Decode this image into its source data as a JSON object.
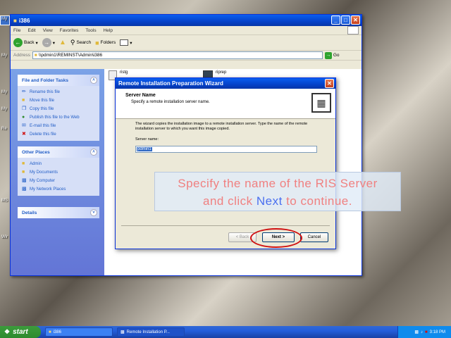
{
  "desktop": {
    "icons": [
      "My",
      "My",
      "My",
      "My",
      "Re",
      "MS",
      "Wir"
    ]
  },
  "explorer": {
    "title": "i386",
    "menu": [
      "File",
      "Edit",
      "View",
      "Favorites",
      "Tools",
      "Help"
    ],
    "toolbar": {
      "back": "Back",
      "search": "Search",
      "folders": "Folders"
    },
    "address_label": "Address",
    "address_value": "\\\\pdmin1\\REMINST\\Admin\\i386",
    "go": "Go",
    "file_tasks": {
      "header": "File and Folder Tasks",
      "items": [
        "Rename this file",
        "Move this file",
        "Copy this file",
        "Publish this file to the Web",
        "E-mail this file",
        "Delete this file"
      ]
    },
    "other_places": {
      "header": "Other Places",
      "items": [
        "Admin",
        "My Documents",
        "My Computer",
        "My Network Places"
      ]
    },
    "details": {
      "header": "Details"
    },
    "files": [
      "ristg",
      "riprep"
    ]
  },
  "wizard": {
    "title": "Remote Installation Preparation Wizard",
    "heading": "Server Name",
    "subheading": "Specify a remote installation server name.",
    "description": "The wizard copies the installation image to a remote installation server. Type the name of the remote installation server to which you want this image copied.",
    "field_label": "Server name:",
    "field_value": "pdmin1",
    "back": "< Back",
    "next": "Next >",
    "cancel": "Cancel"
  },
  "overlay": {
    "line1": "Specify the name of the RIS Server",
    "line2_pre": "and click ",
    "line2_key": "Next",
    "line2_post": " to continue."
  },
  "taskbar": {
    "start": "start",
    "tasks": [
      "i386",
      "Remote Installation P..."
    ],
    "clock": "3:18 PM"
  },
  "colors": {
    "xp_blue": "#0a5ef0",
    "overlay_red": "#f08080",
    "overlay_blue": "#4a6ff0",
    "highlight_ring": "#d01010"
  }
}
